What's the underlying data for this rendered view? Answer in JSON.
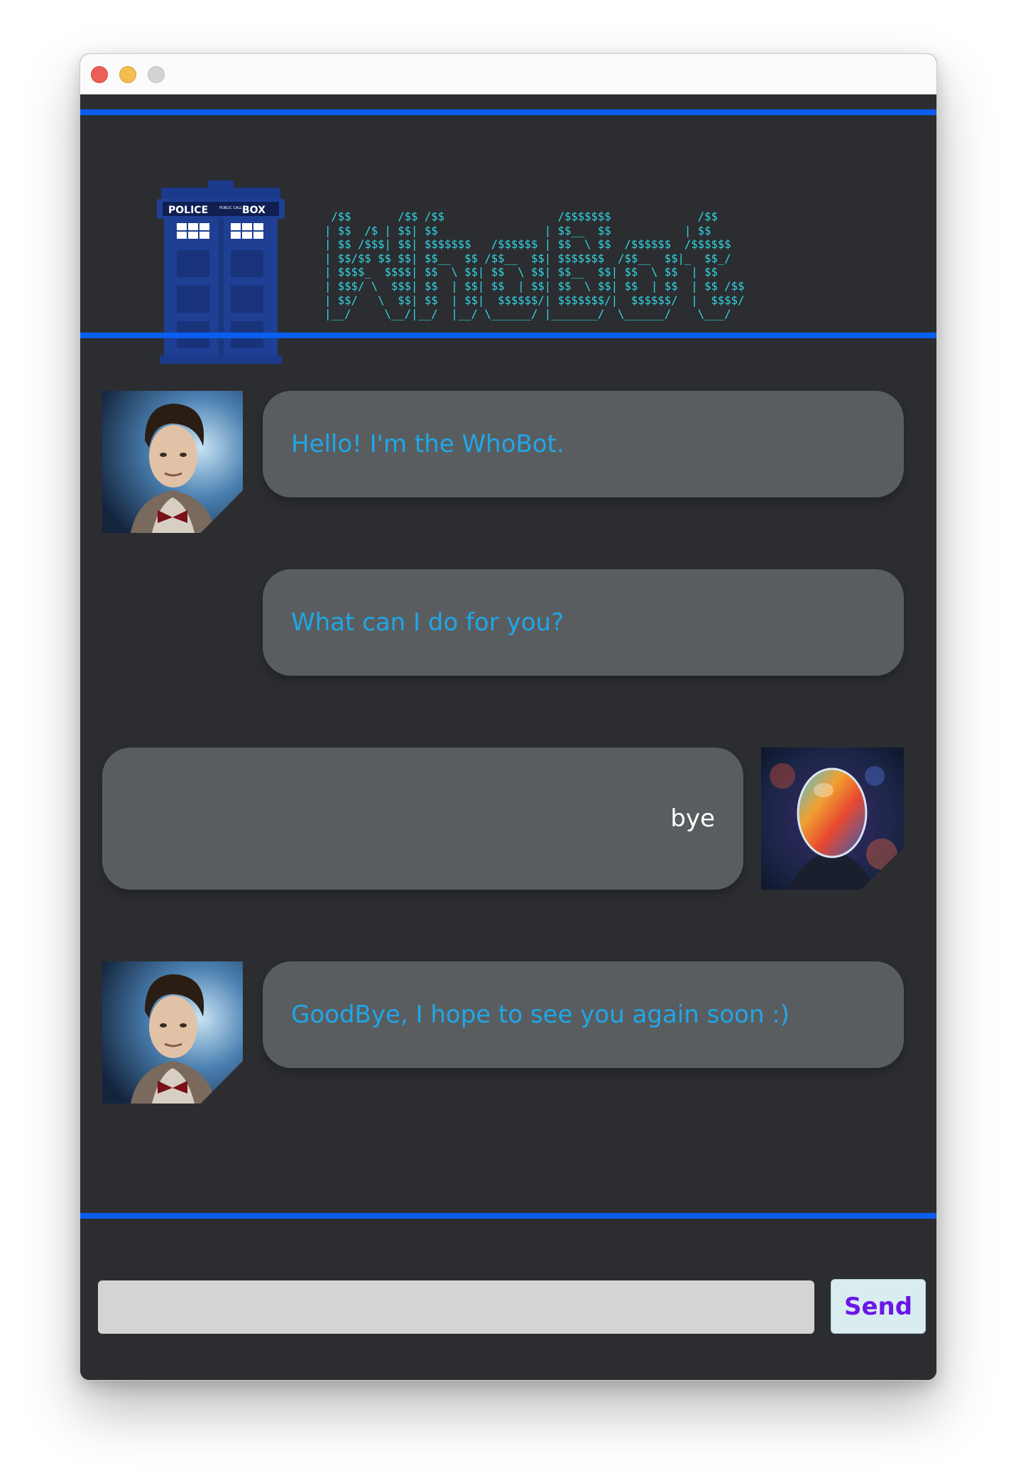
{
  "header": {
    "ascii_logo": " /$$       /$$ /$$                 /$$$$$$$             /$$\n| $$  /$ | $$| $$                | $$__  $$           | $$\n| $$ /$$$| $$| $$$$$$$   /$$$$$$ | $$  \\ $$  /$$$$$$  /$$$$$$\n| $$/$$ $$ $$| $$__  $$ /$$__  $$| $$$$$$$  /$$__  $$|_  $$_/\n| $$$$_  $$$$| $$  \\ $$| $$  \\ $$| $$__  $$| $$  \\ $$  | $$\n| $$$/ \\  $$$| $$  | $$| $$  | $$| $$  \\ $$| $$  | $$  | $$ /$$\n| $$/   \\  $$| $$  | $$|  $$$$$$/| $$$$$$$/|  $$$$$$/  |  $$$$/\n|__/     \\__/|__/  |__/ \\______/ |_______/  \\______/    \\___/",
    "logo_sign_left": "POLICE",
    "logo_sign_small": "PUBLIC CALL",
    "logo_sign_right": "BOX"
  },
  "messages": [
    {
      "sender": "bot",
      "text": "Hello! I'm the WhoBot."
    },
    {
      "sender": "bot",
      "text": "What can I do for you?"
    },
    {
      "sender": "user",
      "text": "bye"
    },
    {
      "sender": "bot",
      "text": "GoodBye, I hope to see you again soon :)"
    }
  ],
  "input": {
    "value": "",
    "placeholder": ""
  },
  "send_label": "Send",
  "colors": {
    "background": "#2b2d31",
    "divider": "#0a5ef0",
    "bubble": "#5a5d5f",
    "bot_text": "#1fa7e8",
    "user_text": "#ffffff",
    "ascii": "#33d6e2",
    "send_text": "#6b17e8",
    "send_bg": "#d9ecef"
  }
}
